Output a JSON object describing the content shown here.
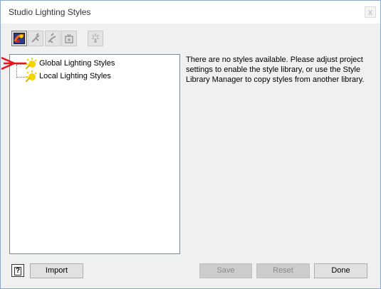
{
  "window": {
    "title": "Studio Lighting Styles",
    "close_label": "x"
  },
  "toolbar": {
    "buttons": [
      {
        "icon": "lighting-style-icon",
        "enabled": true
      },
      {
        "icon": "new-light-icon",
        "enabled": false
      },
      {
        "icon": "edit-light-icon",
        "enabled": false
      },
      {
        "icon": "copy-light-icon",
        "enabled": false
      },
      {
        "icon": "spotlight-icon",
        "enabled": false
      }
    ]
  },
  "tree": {
    "items": [
      {
        "label": "Global Lighting Styles",
        "icon": "sun-icon"
      },
      {
        "label": "Local Lighting Styles",
        "icon": "sun-icon"
      }
    ]
  },
  "message": "There are no styles available.  Please adjust project settings to enable the style library, or use the Style Library Manager to copy styles from another library.",
  "buttons": {
    "help_label": "?",
    "import_label": "Import",
    "save_label": "Save",
    "reset_label": "Reset",
    "done_label": "Done"
  },
  "colors": {
    "arrow": "#e8141c",
    "sun": "#f5d400"
  }
}
